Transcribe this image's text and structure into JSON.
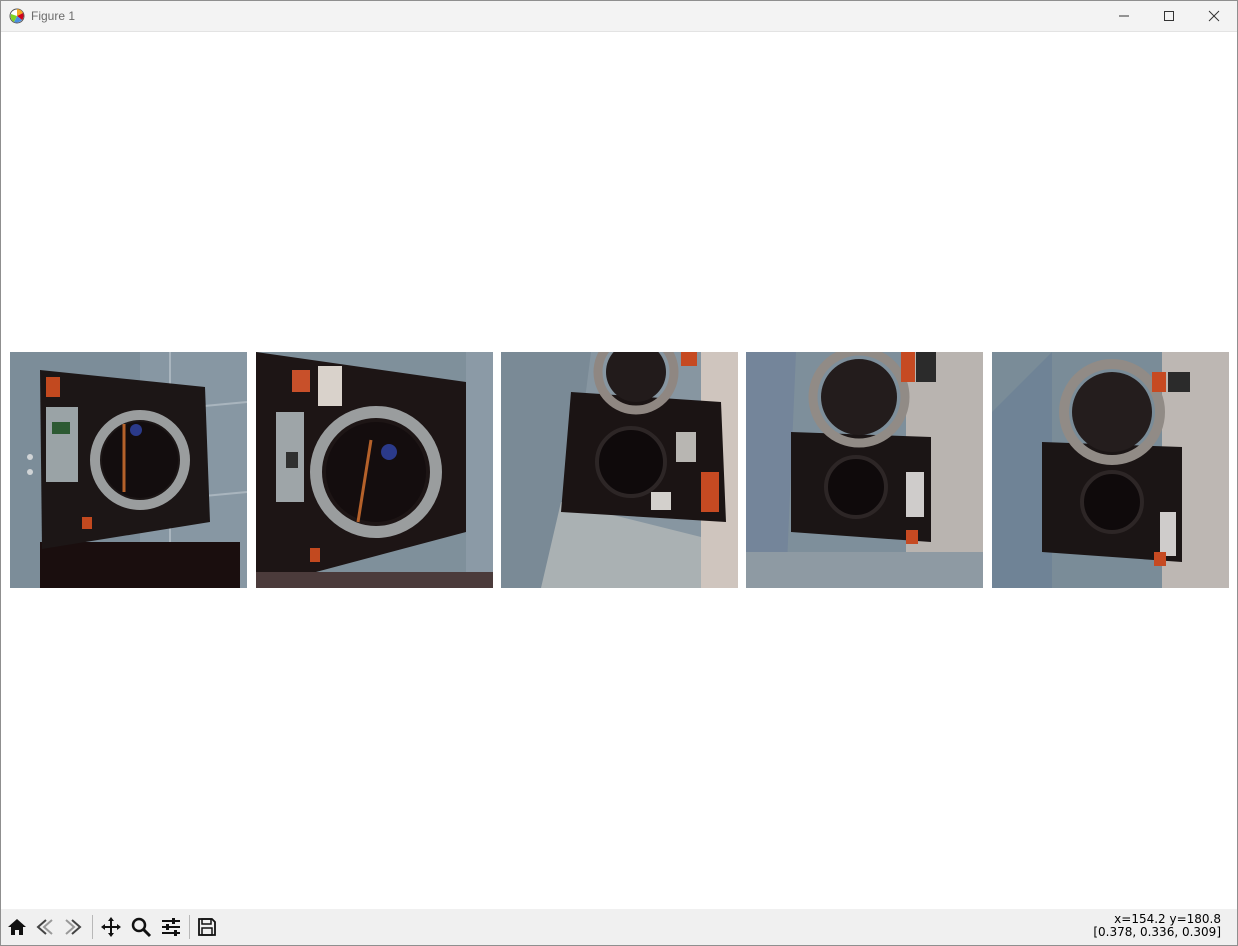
{
  "window": {
    "title": "Figure 1",
    "controls": [
      "minimize-icon",
      "maximize-icon",
      "close-icon"
    ]
  },
  "figure": {
    "subplots": [
      {
        "content": "laundromat washer photo, rotated"
      },
      {
        "content": "laundromat washer photo, rotated"
      },
      {
        "content": "laundromat washer photo, rotated"
      },
      {
        "content": "laundromat washer photo, rotated"
      },
      {
        "content": "laundromat washer photo, rotated"
      }
    ]
  },
  "toolbar": {
    "tools": [
      "home-icon",
      "back-icon",
      "forward-icon",
      "pan-icon",
      "zoom-icon",
      "configure-subplots-icon",
      "save-icon"
    ]
  },
  "status": {
    "coords": "x=154.2 y=180.8",
    "pixel_value": "[0.378, 0.336, 0.309]"
  },
  "colors": {
    "titlebar": "#f3f3f3",
    "toolbar": "#f0f0f0",
    "canvas": "#ffffff"
  }
}
